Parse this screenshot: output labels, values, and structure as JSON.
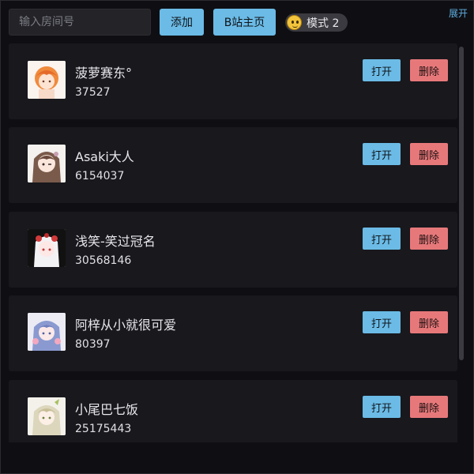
{
  "search": {
    "placeholder": "输入房间号"
  },
  "toolbar": {
    "add_label": "添加",
    "home_label": "B站主页",
    "mode_label": "模式 2",
    "expand_label": "展开"
  },
  "rooms": [
    {
      "name": "菠萝赛东°",
      "room_id": "37527",
      "open_label": "打开",
      "delete_label": "删除"
    },
    {
      "name": "Asaki大人",
      "room_id": "6154037",
      "open_label": "打开",
      "delete_label": "删除"
    },
    {
      "name": "浅笑-笑过冠名",
      "room_id": "30568146",
      "open_label": "打开",
      "delete_label": "删除"
    },
    {
      "name": "阿梓从小就很可爱",
      "room_id": "80397",
      "open_label": "打开",
      "delete_label": "删除"
    },
    {
      "name": "小尾巴七饭",
      "room_id": "25175443",
      "open_label": "打开",
      "delete_label": "删除"
    }
  ],
  "colors": {
    "accent_blue": "#6bbbe6",
    "danger_red": "#e7787a",
    "card_bg": "#18181d",
    "page_bg": "#0f0f13"
  }
}
